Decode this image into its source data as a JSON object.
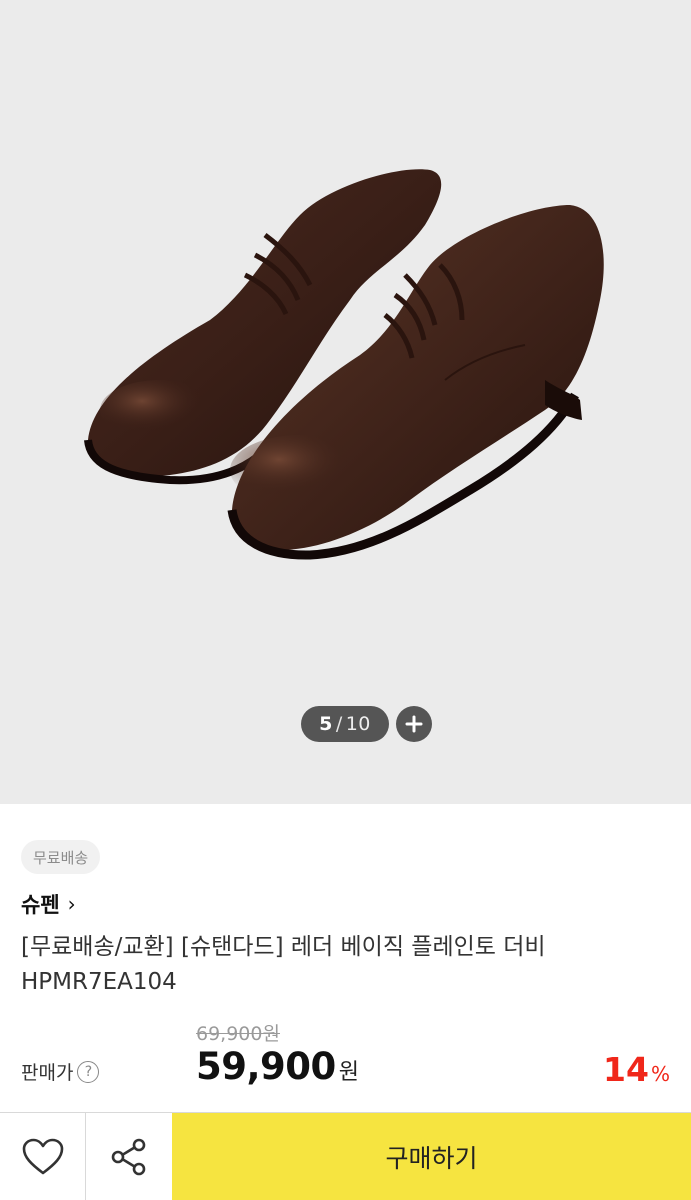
{
  "gallery": {
    "current": "5",
    "separator": "/",
    "total": "10",
    "zoom_icon": "plus-icon",
    "image": "brown leather plain-toe derby shoes"
  },
  "product": {
    "badge": "무료배송",
    "brand": "슈펜",
    "brand_chevron": "›",
    "title": "[무료배송/교환] [슈탠다드] 레더 베이직 플레인토 더비 HPMR7EA104",
    "original_price": "69,900원",
    "price_label": "판매가",
    "help_symbol": "?",
    "price": "59,900",
    "currency": "원",
    "discount": "14",
    "discount_symbol": "%"
  },
  "bottom_bar": {
    "wishlist_icon": "heart-icon",
    "share_icon": "share-icon",
    "buy_label": "구매하기"
  },
  "colors": {
    "accent_yellow": "#f6e440",
    "discount_red": "#f0271a",
    "pager_bg": "#555555"
  }
}
